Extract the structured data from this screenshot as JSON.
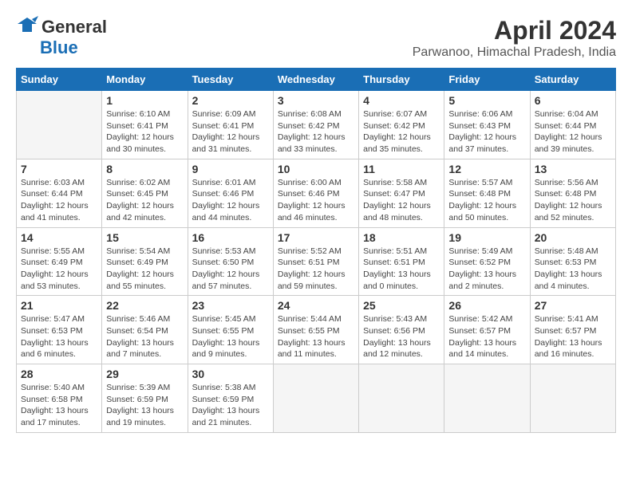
{
  "logo": {
    "line1": "General",
    "line2": "Blue"
  },
  "title": "April 2024",
  "subtitle": "Parwanoo, Himachal Pradesh, India",
  "weekdays": [
    "Sunday",
    "Monday",
    "Tuesday",
    "Wednesday",
    "Thursday",
    "Friday",
    "Saturday"
  ],
  "weeks": [
    [
      {
        "day": "",
        "info": ""
      },
      {
        "day": "1",
        "info": "Sunrise: 6:10 AM\nSunset: 6:41 PM\nDaylight: 12 hours\nand 30 minutes."
      },
      {
        "day": "2",
        "info": "Sunrise: 6:09 AM\nSunset: 6:41 PM\nDaylight: 12 hours\nand 31 minutes."
      },
      {
        "day": "3",
        "info": "Sunrise: 6:08 AM\nSunset: 6:42 PM\nDaylight: 12 hours\nand 33 minutes."
      },
      {
        "day": "4",
        "info": "Sunrise: 6:07 AM\nSunset: 6:42 PM\nDaylight: 12 hours\nand 35 minutes."
      },
      {
        "day": "5",
        "info": "Sunrise: 6:06 AM\nSunset: 6:43 PM\nDaylight: 12 hours\nand 37 minutes."
      },
      {
        "day": "6",
        "info": "Sunrise: 6:04 AM\nSunset: 6:44 PM\nDaylight: 12 hours\nand 39 minutes."
      }
    ],
    [
      {
        "day": "7",
        "info": "Sunrise: 6:03 AM\nSunset: 6:44 PM\nDaylight: 12 hours\nand 41 minutes."
      },
      {
        "day": "8",
        "info": "Sunrise: 6:02 AM\nSunset: 6:45 PM\nDaylight: 12 hours\nand 42 minutes."
      },
      {
        "day": "9",
        "info": "Sunrise: 6:01 AM\nSunset: 6:46 PM\nDaylight: 12 hours\nand 44 minutes."
      },
      {
        "day": "10",
        "info": "Sunrise: 6:00 AM\nSunset: 6:46 PM\nDaylight: 12 hours\nand 46 minutes."
      },
      {
        "day": "11",
        "info": "Sunrise: 5:58 AM\nSunset: 6:47 PM\nDaylight: 12 hours\nand 48 minutes."
      },
      {
        "day": "12",
        "info": "Sunrise: 5:57 AM\nSunset: 6:48 PM\nDaylight: 12 hours\nand 50 minutes."
      },
      {
        "day": "13",
        "info": "Sunrise: 5:56 AM\nSunset: 6:48 PM\nDaylight: 12 hours\nand 52 minutes."
      }
    ],
    [
      {
        "day": "14",
        "info": "Sunrise: 5:55 AM\nSunset: 6:49 PM\nDaylight: 12 hours\nand 53 minutes."
      },
      {
        "day": "15",
        "info": "Sunrise: 5:54 AM\nSunset: 6:49 PM\nDaylight: 12 hours\nand 55 minutes."
      },
      {
        "day": "16",
        "info": "Sunrise: 5:53 AM\nSunset: 6:50 PM\nDaylight: 12 hours\nand 57 minutes."
      },
      {
        "day": "17",
        "info": "Sunrise: 5:52 AM\nSunset: 6:51 PM\nDaylight: 12 hours\nand 59 minutes."
      },
      {
        "day": "18",
        "info": "Sunrise: 5:51 AM\nSunset: 6:51 PM\nDaylight: 13 hours\nand 0 minutes."
      },
      {
        "day": "19",
        "info": "Sunrise: 5:49 AM\nSunset: 6:52 PM\nDaylight: 13 hours\nand 2 minutes."
      },
      {
        "day": "20",
        "info": "Sunrise: 5:48 AM\nSunset: 6:53 PM\nDaylight: 13 hours\nand 4 minutes."
      }
    ],
    [
      {
        "day": "21",
        "info": "Sunrise: 5:47 AM\nSunset: 6:53 PM\nDaylight: 13 hours\nand 6 minutes."
      },
      {
        "day": "22",
        "info": "Sunrise: 5:46 AM\nSunset: 6:54 PM\nDaylight: 13 hours\nand 7 minutes."
      },
      {
        "day": "23",
        "info": "Sunrise: 5:45 AM\nSunset: 6:55 PM\nDaylight: 13 hours\nand 9 minutes."
      },
      {
        "day": "24",
        "info": "Sunrise: 5:44 AM\nSunset: 6:55 PM\nDaylight: 13 hours\nand 11 minutes."
      },
      {
        "day": "25",
        "info": "Sunrise: 5:43 AM\nSunset: 6:56 PM\nDaylight: 13 hours\nand 12 minutes."
      },
      {
        "day": "26",
        "info": "Sunrise: 5:42 AM\nSunset: 6:57 PM\nDaylight: 13 hours\nand 14 minutes."
      },
      {
        "day": "27",
        "info": "Sunrise: 5:41 AM\nSunset: 6:57 PM\nDaylight: 13 hours\nand 16 minutes."
      }
    ],
    [
      {
        "day": "28",
        "info": "Sunrise: 5:40 AM\nSunset: 6:58 PM\nDaylight: 13 hours\nand 17 minutes."
      },
      {
        "day": "29",
        "info": "Sunrise: 5:39 AM\nSunset: 6:59 PM\nDaylight: 13 hours\nand 19 minutes."
      },
      {
        "day": "30",
        "info": "Sunrise: 5:38 AM\nSunset: 6:59 PM\nDaylight: 13 hours\nand 21 minutes."
      },
      {
        "day": "",
        "info": ""
      },
      {
        "day": "",
        "info": ""
      },
      {
        "day": "",
        "info": ""
      },
      {
        "day": "",
        "info": ""
      }
    ]
  ]
}
